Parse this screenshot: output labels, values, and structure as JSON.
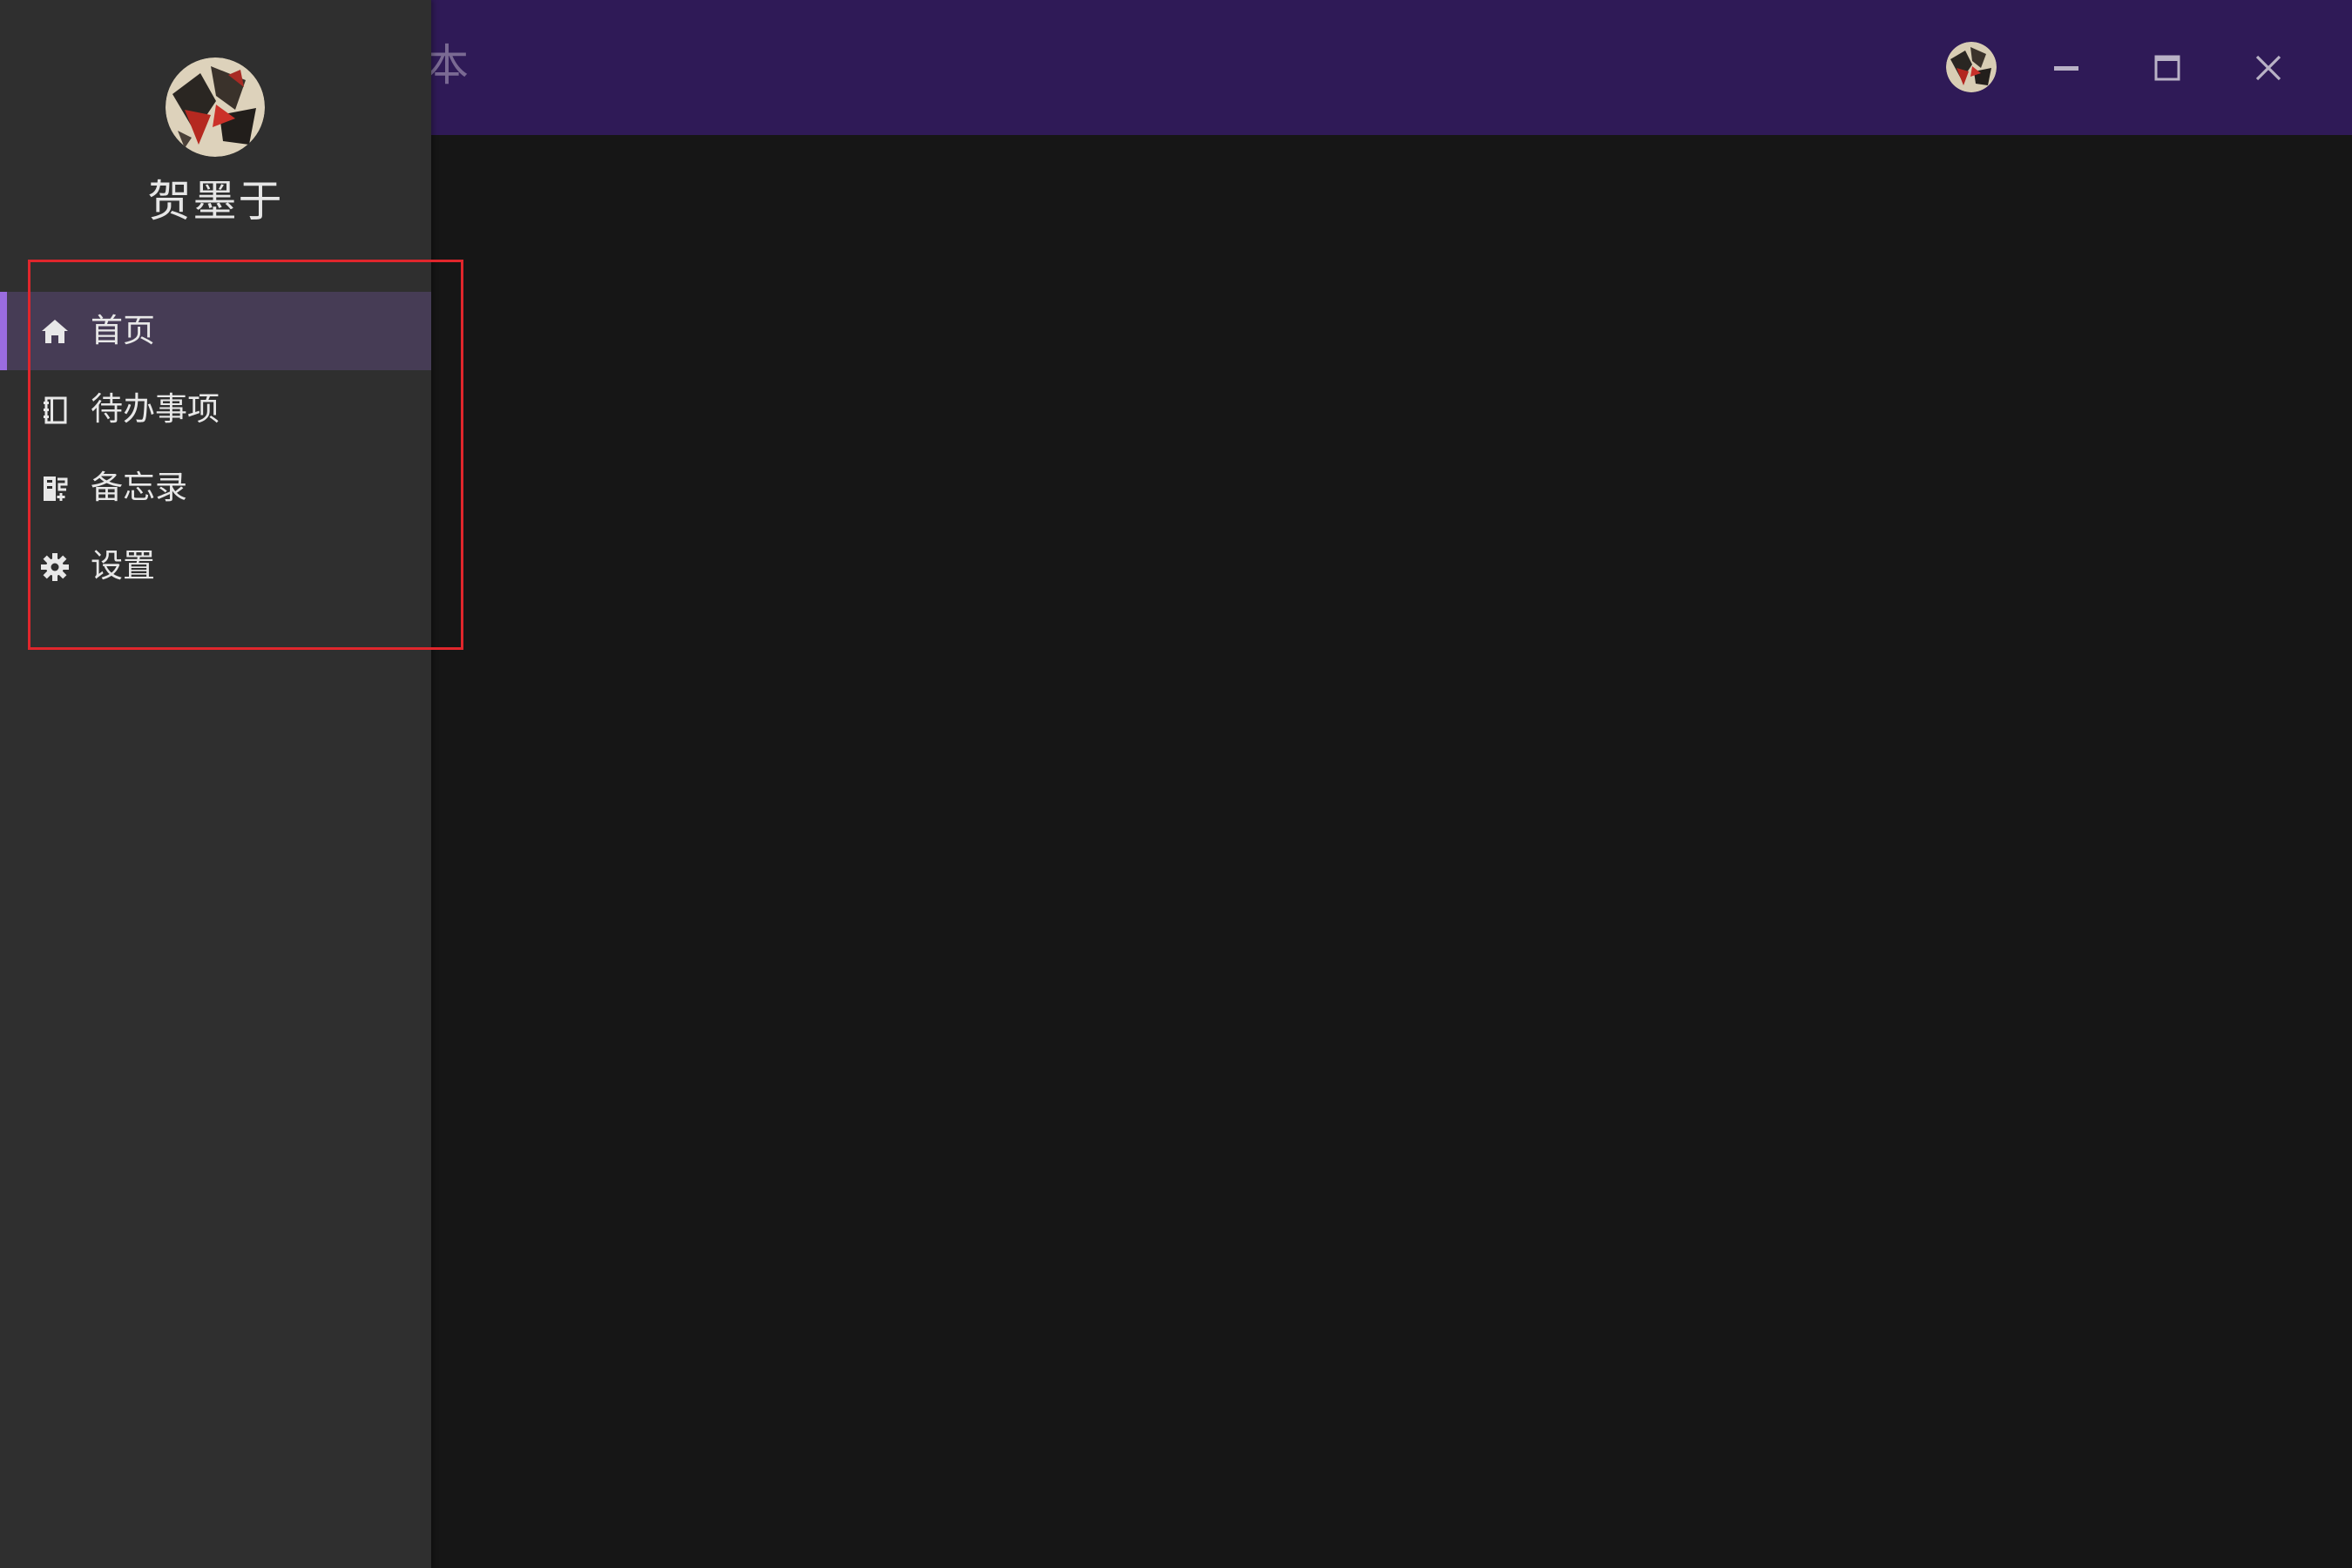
{
  "window": {
    "title": "本",
    "controls": {
      "minimize_icon": "minimize-icon",
      "maximize_icon": "maximize-icon",
      "close_icon": "close-icon"
    }
  },
  "drawer": {
    "user_name": "贺墨于",
    "menu": [
      {
        "label": "首页",
        "icon": "home-icon",
        "active": true
      },
      {
        "label": "待办事项",
        "icon": "notebook-icon",
        "active": false
      },
      {
        "label": "备忘录",
        "icon": "memo-icon",
        "active": false
      },
      {
        "label": "设置",
        "icon": "gear-icon",
        "active": false
      }
    ]
  },
  "colors": {
    "titlebar": "#2f1a57",
    "drawer": "#2f2f2f",
    "content": "#161616",
    "active_item": "#463c55",
    "accent": "#9a6ce0",
    "highlight": "#e0262c"
  }
}
